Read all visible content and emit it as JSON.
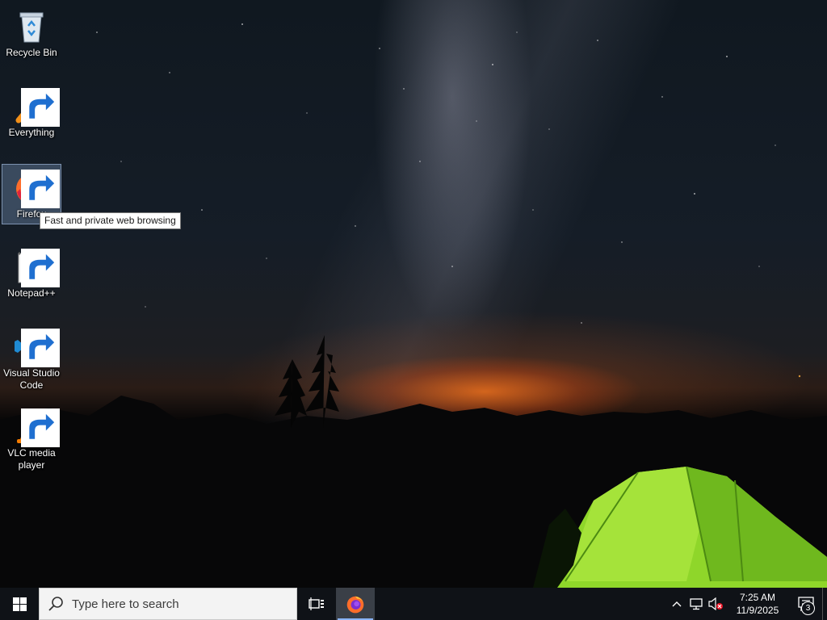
{
  "desktop": {
    "icons": [
      {
        "label": "Recycle Bin",
        "icon": "recycle-bin-icon"
      },
      {
        "label": "Everything",
        "icon": "everything-search-icon"
      },
      {
        "label": "Firefox",
        "icon": "firefox-icon"
      },
      {
        "label": "Notepad++",
        "icon": "notepad-plus-plus-icon"
      },
      {
        "label": "Visual Studio Code",
        "icon": "vscode-icon"
      },
      {
        "label": "VLC media player",
        "icon": "vlc-icon"
      }
    ],
    "tooltip": "Fast and private web browsing"
  },
  "taskbar": {
    "search_placeholder": "Type here to search",
    "pinned": [
      {
        "name": "Firefox",
        "icon": "firefox-icon",
        "active": true
      }
    ],
    "clock": {
      "time": "7:25 AM",
      "date": "11/9/2025"
    },
    "notification_count": "3"
  },
  "colors": {
    "taskbar_bg": "#0f1217",
    "selection": "#82a0c8",
    "tent_green": "#7ed321",
    "horizon_orange": "#ff7a1e"
  }
}
